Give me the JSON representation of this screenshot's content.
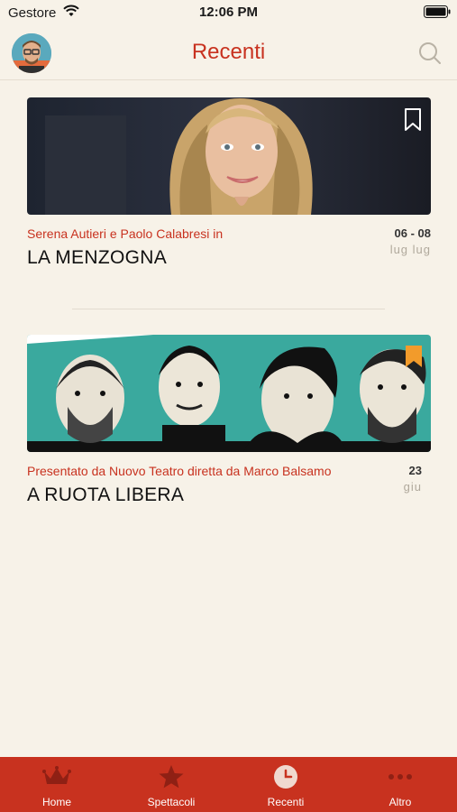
{
  "status_bar": {
    "carrier": "Gestore",
    "time": "12:06 PM"
  },
  "nav": {
    "title": "Recenti"
  },
  "cards": [
    {
      "subtitle": "Serena Autieri e Paolo Calabresi in",
      "title": "LA MENZOGNA",
      "date_days": "06 - 08",
      "date_months": "lug  lug",
      "bookmarked": false
    },
    {
      "subtitle": "Presentato da Nuovo Teatro diretta da Marco Balsamo",
      "title": "A RUOTA LIBERA",
      "date_days": "23",
      "date_months": "giu",
      "bookmarked": true
    }
  ],
  "tabs": [
    {
      "label": "Home",
      "icon": "crown-icon"
    },
    {
      "label": "Spettacoli",
      "icon": "star-icon"
    },
    {
      "label": "Recenti",
      "icon": "clock-icon",
      "active": true
    },
    {
      "label": "Altro",
      "icon": "more-dots-icon"
    }
  ],
  "colors": {
    "accent": "#c8321f",
    "background": "#f7f2e8",
    "teal": "#3aa99e",
    "bookmark_active": "#f29b2b"
  }
}
